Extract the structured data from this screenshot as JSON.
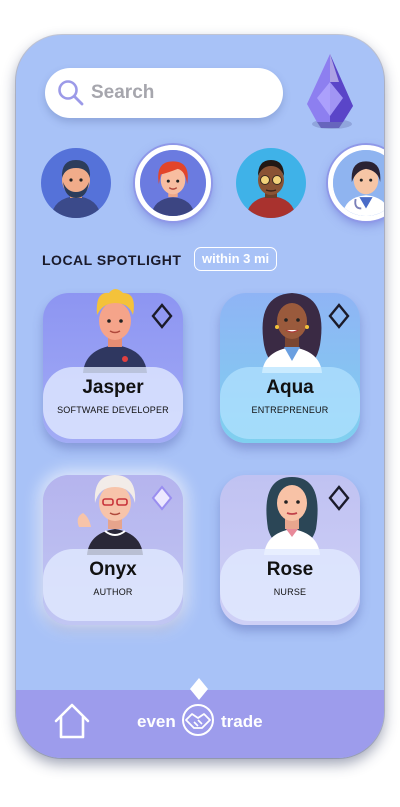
{
  "search": {
    "placeholder": "Search"
  },
  "stories": [
    {
      "id": "story-1",
      "name": "bearded-man"
    },
    {
      "id": "story-2",
      "name": "redhead-woman"
    },
    {
      "id": "story-3",
      "name": "man-with-glasses"
    },
    {
      "id": "story-4",
      "name": "doctor"
    }
  ],
  "spotlight": {
    "title": "LOCAL SPOTLIGHT",
    "radius_label": "within 3 mi",
    "cards": [
      {
        "name": "Jasper",
        "role": "SOFTWARE DEVELOPER"
      },
      {
        "name": "Aqua",
        "role": "ENTREPRENEUR"
      },
      {
        "name": "Onyx",
        "role": "AUTHOR"
      },
      {
        "name": "Rose",
        "role": "NURSE"
      }
    ]
  },
  "nav": {
    "brand_left": "even",
    "brand_right": "trade"
  },
  "colors": {
    "background": "#a8c2f7",
    "nav": "#9d9cec",
    "accent": "#8f98e8"
  }
}
